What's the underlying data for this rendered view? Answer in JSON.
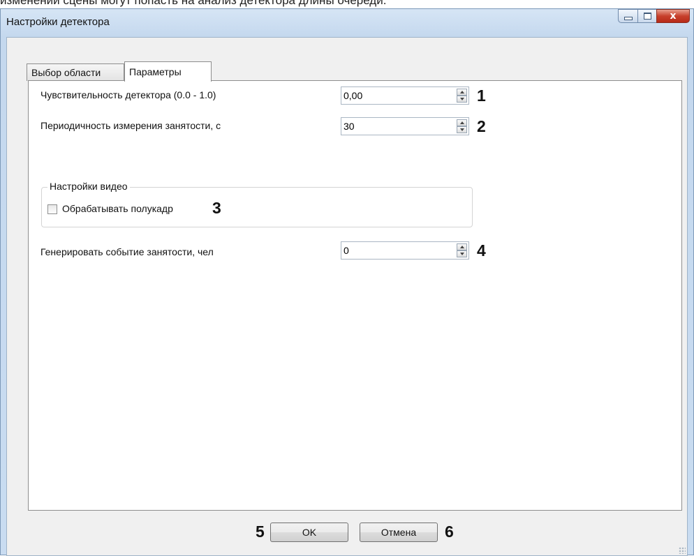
{
  "top_cut_text": "изменении сцены могут попасть на анализ детектора длины очереди.",
  "window": {
    "title": "Настройки детектора",
    "minimize_icon": "minimize-icon",
    "maximize_icon": "maximize-icon",
    "close_icon": "close-icon",
    "close_glyph": "x"
  },
  "tabs": [
    {
      "label": "Выбор области",
      "active": false
    },
    {
      "label": "Параметры",
      "active": true
    }
  ],
  "params": {
    "sensitivity": {
      "label": "Чувствительность детектора (0.0 - 1.0)",
      "value": "0,00",
      "marker": "1"
    },
    "period": {
      "label": "Периодичность измерения занятости, с",
      "value": "30",
      "marker": "2"
    },
    "video_group": {
      "title": "Настройки видео",
      "halfframe": {
        "label": "Обрабатывать полукадр",
        "checked": false,
        "marker": "3"
      }
    },
    "event": {
      "label": "Генерировать событие занятости, чел",
      "value": "0",
      "marker": "4"
    }
  },
  "buttons": {
    "ok": {
      "label": "OK",
      "marker": "5"
    },
    "cancel": {
      "label": "Отмена",
      "marker": "6"
    }
  },
  "colors": {
    "frame": "#c4d8ee",
    "close_button": "#c7402c",
    "panel": "#ffffff"
  }
}
